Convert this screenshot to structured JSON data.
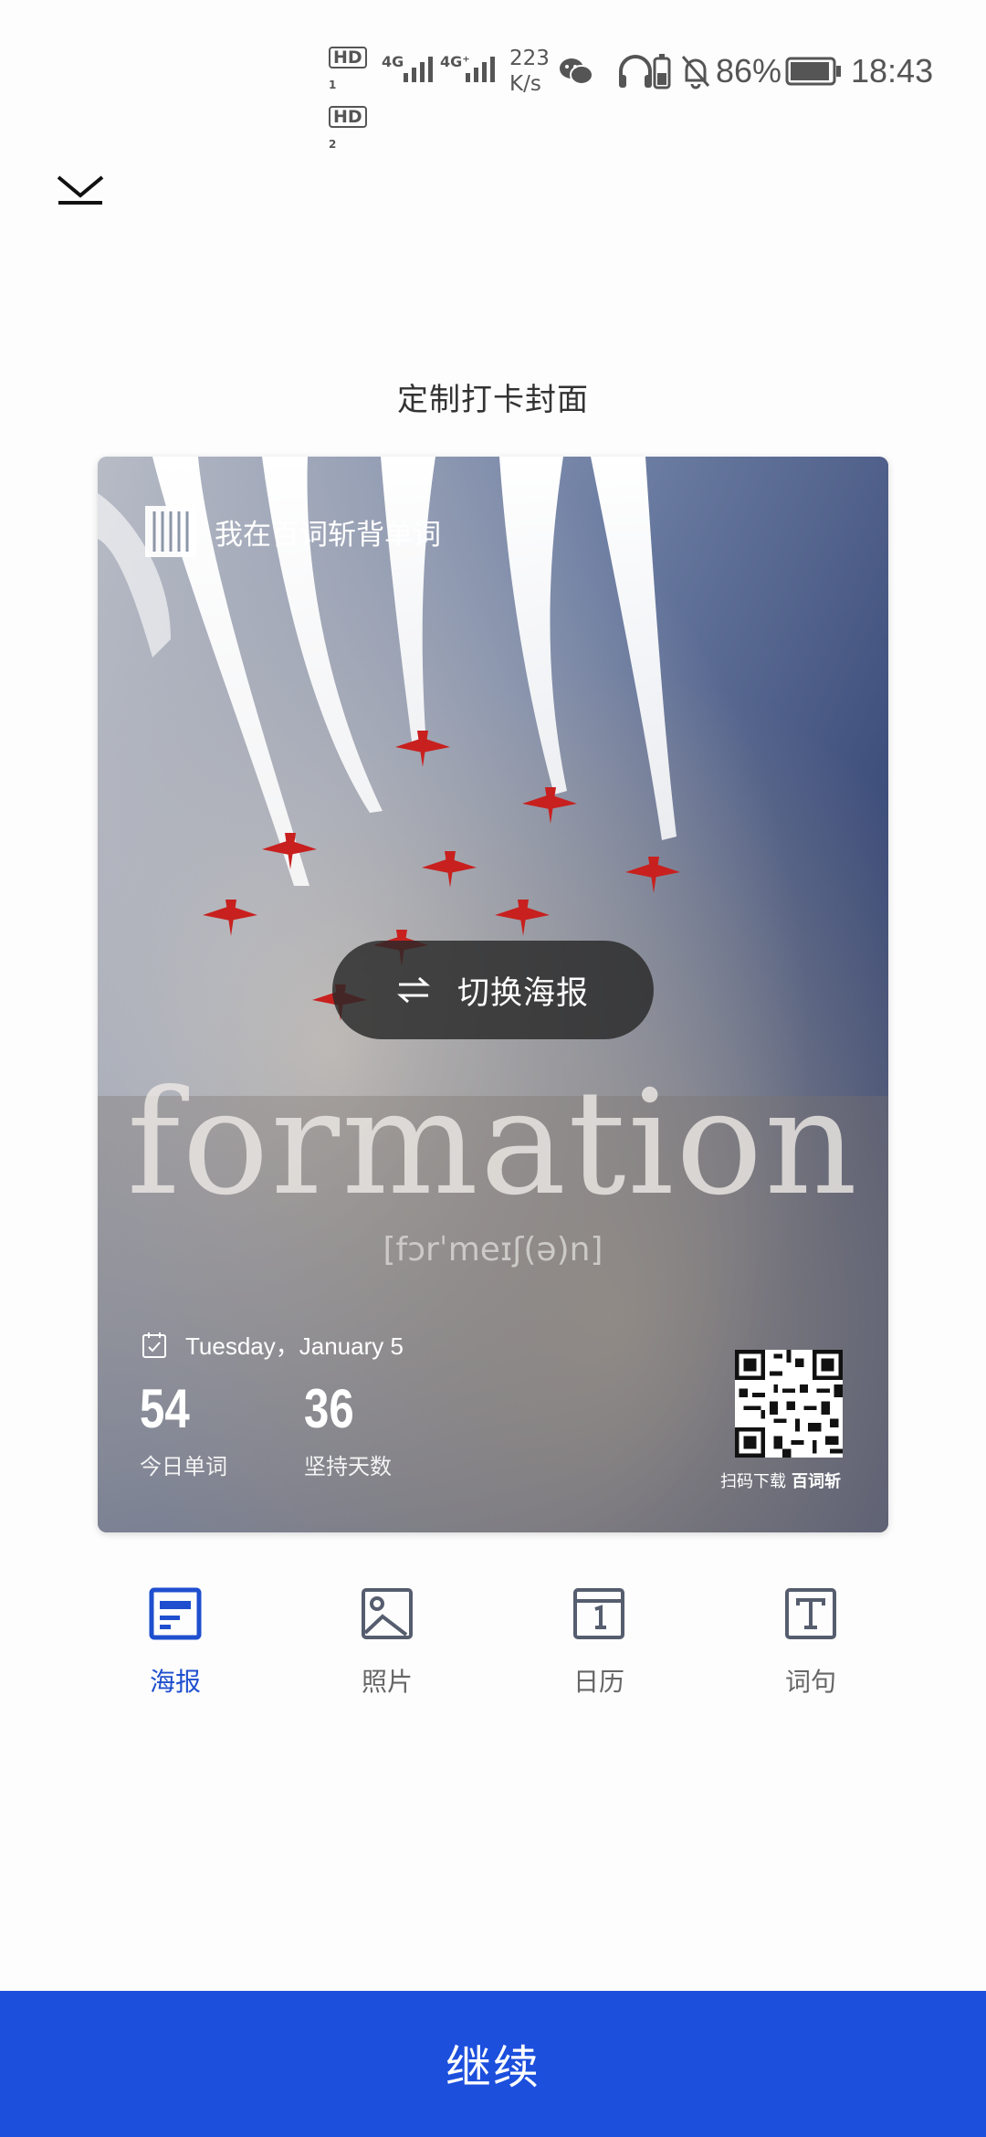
{
  "status_bar": {
    "hd1": "HD",
    "hd1_sub": "1",
    "hd2": "HD",
    "hd2_sub": "2",
    "net1": "4G",
    "net2": "4G⁺",
    "speed_value": "223",
    "speed_unit": "K/s",
    "battery": "86%",
    "time": "18:43"
  },
  "page": {
    "title": "定制打卡封面"
  },
  "poster": {
    "brand_text": "我在百词斩背单词",
    "switch_label": "切换海报",
    "word": "formation",
    "phonetic": "[fɔrˈmeɪʃ(ə)n]",
    "date": "Tuesday，January 5",
    "stats": [
      {
        "value": "54",
        "label": "今日单词"
      },
      {
        "value": "36",
        "label": "坚持天数"
      }
    ],
    "qr_caption": "扫码下载",
    "qr_brand": "百词斩"
  },
  "tabs": [
    {
      "label": "海报",
      "icon": "poster-icon",
      "active": true
    },
    {
      "label": "照片",
      "icon": "photo-icon",
      "active": false
    },
    {
      "label": "日历",
      "icon": "calendar-icon",
      "active": false
    },
    {
      "label": "词句",
      "icon": "text-icon",
      "active": false
    }
  ],
  "continue_label": "继续",
  "colors": {
    "accent": "#1D4FDD",
    "active_tab": "#1F4FCF",
    "inactive_tab": "#666666"
  }
}
